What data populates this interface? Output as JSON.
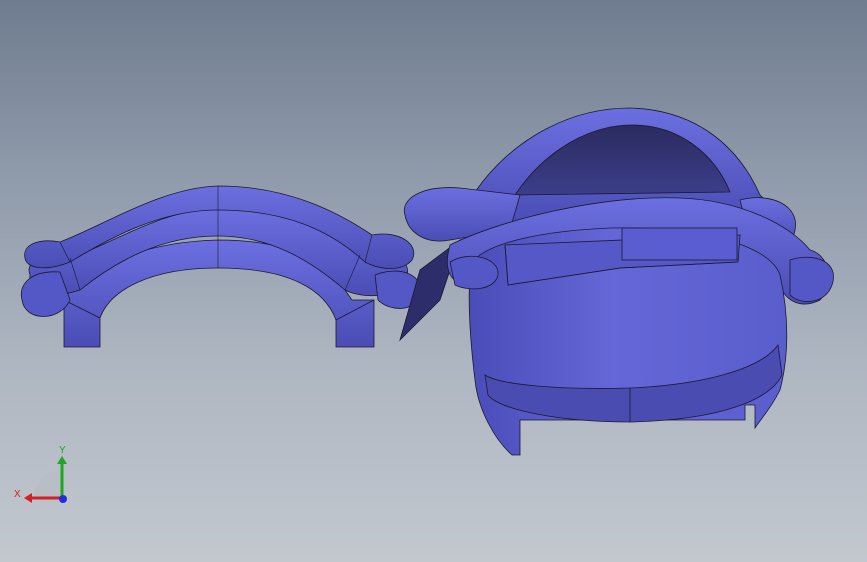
{
  "viewport": {
    "background_top": "#6f7c8f",
    "background_bottom": "#c3c8cf",
    "model_color": "#5f62d4",
    "edge_color": "#1a1a2e"
  },
  "triad": {
    "x_label": "X",
    "y_label": "Y",
    "x_color": "#d42020",
    "y_color": "#1fa81f",
    "z_color": "#2030d8"
  }
}
